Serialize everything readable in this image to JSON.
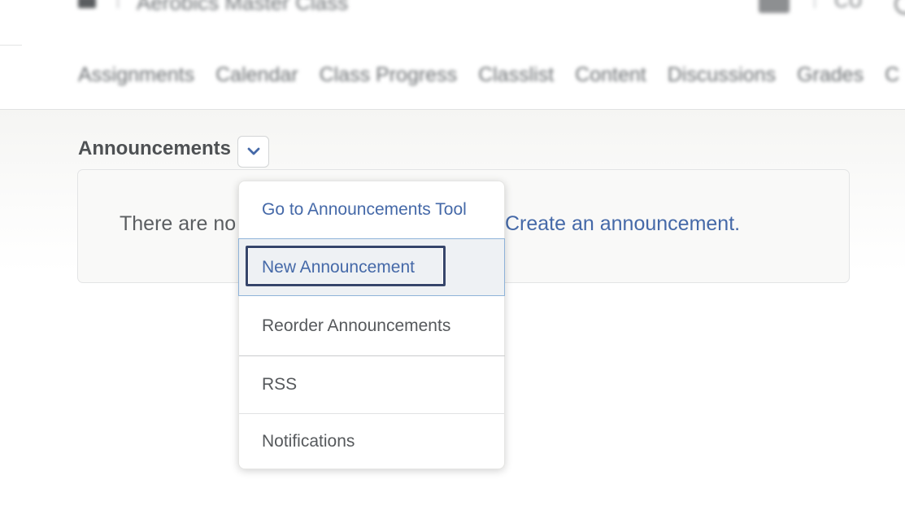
{
  "topbar": {
    "course_title": "Aerobics Master Class",
    "right_text": "CU"
  },
  "nav": {
    "items": [
      "Assignments",
      "Calendar",
      "Class Progress",
      "Classlist",
      "Content",
      "Discussions",
      "Grades",
      "C"
    ]
  },
  "widget": {
    "title": "Announcements",
    "empty_message": "There are no",
    "create_link": "Create an announcement."
  },
  "dropdown": {
    "items": [
      {
        "label": "Go to Announcements Tool"
      },
      {
        "label": "New Announcement"
      },
      {
        "label": "Reorder Announcements"
      },
      {
        "label": "RSS"
      },
      {
        "label": "Notifications"
      }
    ],
    "focused_index": 1
  },
  "icons": {
    "menu_toggle": "chevron-down-icon"
  },
  "colors": {
    "link": "#4569a8",
    "focus_ring": "#37466b",
    "highlight_bg": "#eef1f4",
    "highlight_border": "#8fb3d9"
  }
}
